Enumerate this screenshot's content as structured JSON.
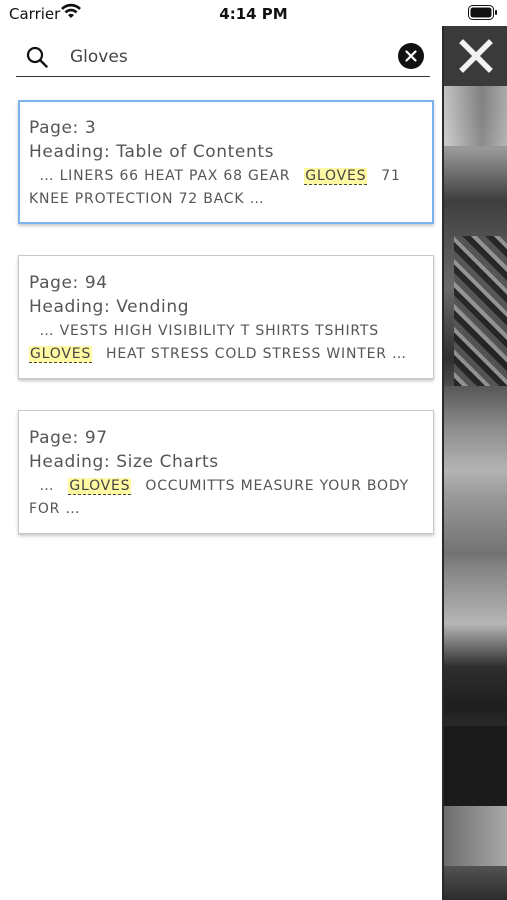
{
  "status_bar": {
    "carrier": "Carrier",
    "time": "4:14 PM"
  },
  "search": {
    "query": "Gloves",
    "placeholder": ""
  },
  "results": [
    {
      "page": "Page: 3",
      "heading": "Heading: Table of Contents",
      "pre": "… LINERS 66 HEAT PAX 68 GEAR",
      "match": "GLOVES",
      "post": "71 KNEE PROTECTION 72 BACK …"
    },
    {
      "page": "Page: 94",
      "heading": "Heading: Vending",
      "pre": "… VESTS HIGH VISIBILITY T SHIRTS TSHIRTS",
      "match": "GLOVES",
      "post": "HEAT STRESS COLD STRESS WINTER …"
    },
    {
      "page": "Page: 97",
      "heading": "Heading: Size Charts",
      "pre": "…",
      "match": "GLOVES",
      "post": "OCCUMITTS MEASURE YOUR BODY FOR …"
    }
  ],
  "colors": {
    "highlight": "#fff9a3",
    "selected_border": "#7fb1ea",
    "text": "#555555"
  },
  "icons": {
    "search": "search-icon",
    "clear": "clear-icon",
    "close": "close-icon",
    "wifi": "wifi-icon",
    "battery": "battery-icon"
  }
}
